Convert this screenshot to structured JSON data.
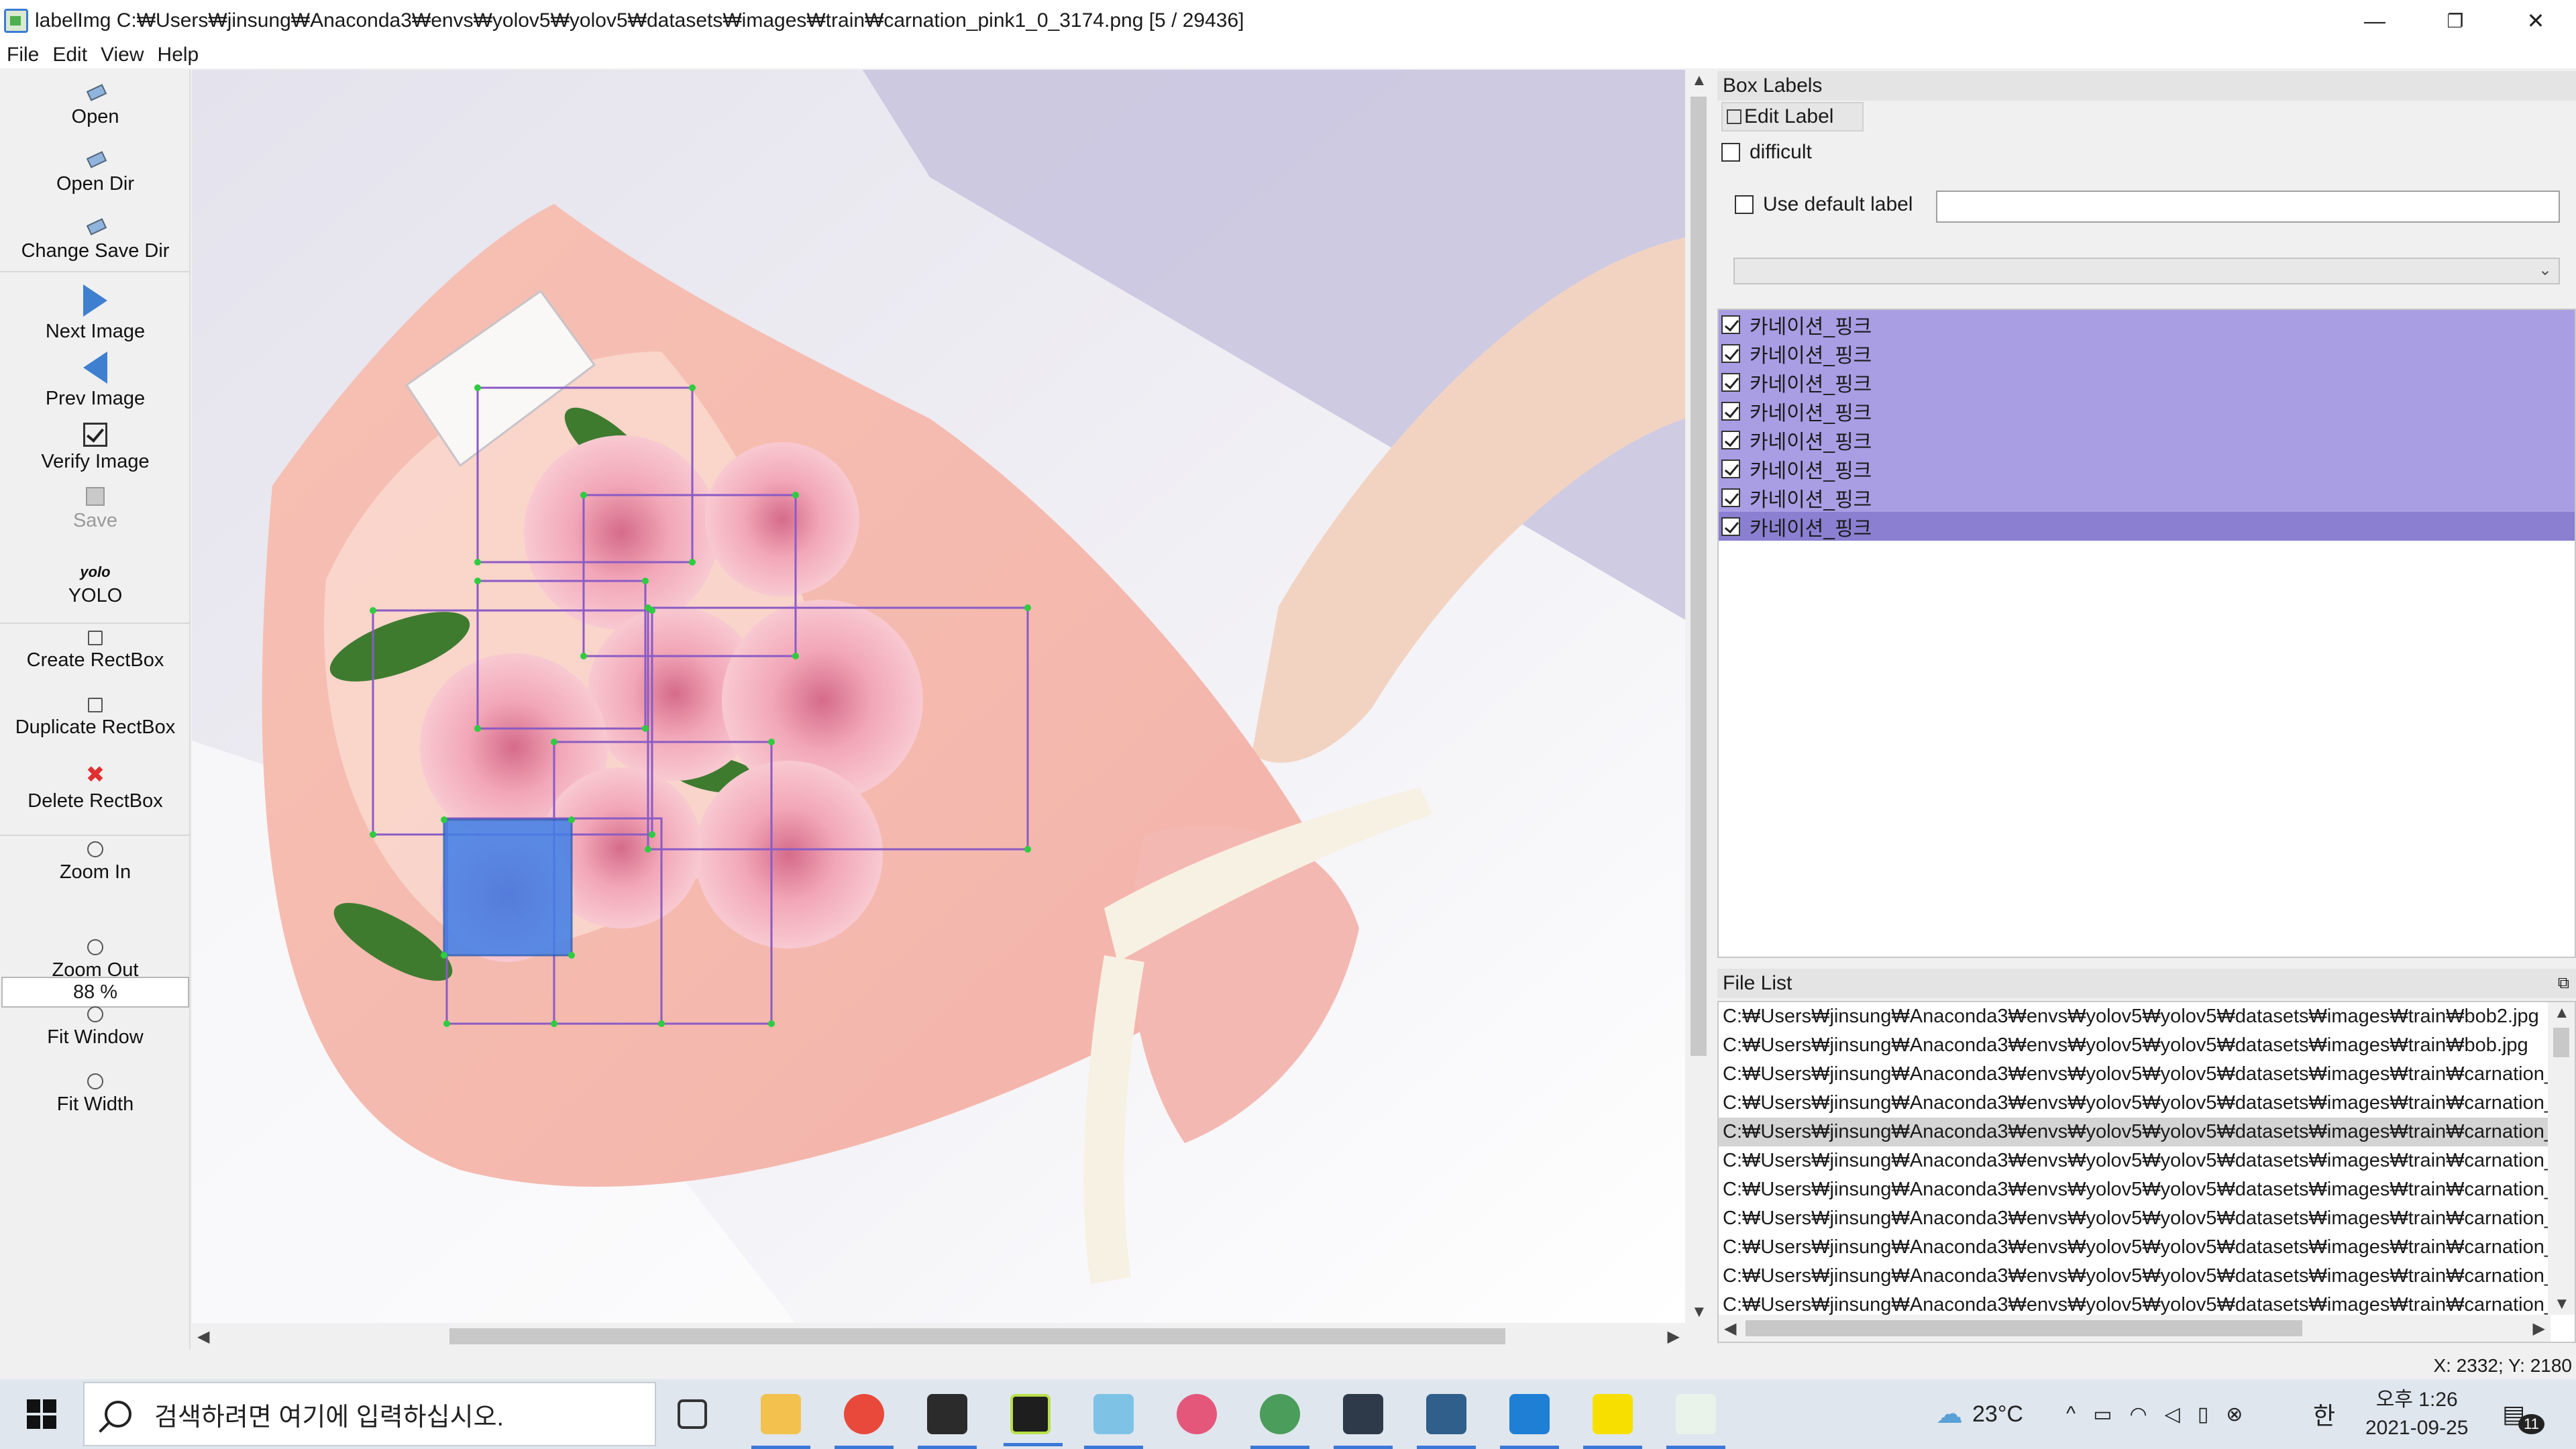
{
  "window": {
    "title": "labelImg C:₩Users₩jinsung₩Anaconda3₩envs₩yolov5₩yolov5₩datasets₩images₩train₩carnation_pink1_0_3174.png [5 / 29436]",
    "minimize": "—",
    "maximize": "❐",
    "close": "✕"
  },
  "menu": [
    "File",
    "Edit",
    "View",
    "Help"
  ],
  "toolbar": {
    "open": "Open",
    "open_dir": "Open Dir",
    "change_save_dir": "Change Save Dir",
    "next_image": "Next Image",
    "prev_image": "Prev Image",
    "verify_image": "Verify Image",
    "save": "Save",
    "yolo_icon": "yolo",
    "yolo": "YOLO",
    "create_rectbox": "Create RectBox",
    "duplicate_rectbox": "Duplicate RectBox",
    "delete_rectbox": "Delete RectBox",
    "zoom_in": "Zoom In",
    "zoom_value": "88 %",
    "zoom_out": "Zoom Out",
    "fit_window": "Fit Window",
    "fit_width": "Fit Width"
  },
  "box_labels": {
    "title": "Box Labels",
    "edit_label": "Edit Label",
    "difficult": "difficult",
    "use_default_label": "Use default label",
    "default_label_value": "",
    "labels": [
      "카네이션_핑크",
      "카네이션_핑크",
      "카네이션_핑크",
      "카네이션_핑크",
      "카네이션_핑크",
      "카네이션_핑크",
      "카네이션_핑크",
      "카네이션_핑크"
    ],
    "selected_index": 7
  },
  "file_list": {
    "title": "File List",
    "files": [
      "C:₩Users₩jinsung₩Anaconda3₩envs₩yolov5₩yolov5₩datasets₩images₩train₩bob2.jpg",
      "C:₩Users₩jinsung₩Anaconda3₩envs₩yolov5₩yolov5₩datasets₩images₩train₩bob.jpg",
      "C:₩Users₩jinsung₩Anaconda3₩envs₩yolov5₩yolov5₩datasets₩images₩train₩carnation_",
      "C:₩Users₩jinsung₩Anaconda3₩envs₩yolov5₩yolov5₩datasets₩images₩train₩carnation_",
      "C:₩Users₩jinsung₩Anaconda3₩envs₩yolov5₩yolov5₩datasets₩images₩train₩carnation_",
      "C:₩Users₩jinsung₩Anaconda3₩envs₩yolov5₩yolov5₩datasets₩images₩train₩carnation_",
      "C:₩Users₩jinsung₩Anaconda3₩envs₩yolov5₩yolov5₩datasets₩images₩train₩carnation_",
      "C:₩Users₩jinsung₩Anaconda3₩envs₩yolov5₩yolov5₩datasets₩images₩train₩carnation_",
      "C:₩Users₩jinsung₩Anaconda3₩envs₩yolov5₩yolov5₩datasets₩images₩train₩carnation_",
      "C:₩Users₩jinsung₩Anaconda3₩envs₩yolov5₩yolov5₩datasets₩images₩train₩carnation_",
      "C:₩Users₩jinsung₩Anaconda3₩envs₩yolov5₩yolov5₩datasets₩images₩train₩carnation_"
    ],
    "selected_index": 4
  },
  "status": {
    "coords": "X: 2332; Y: 2180"
  },
  "taskbar": {
    "search_placeholder": "검색하려면 여기에 입력하십시오.",
    "apps": [
      "task-view",
      "file-explorer",
      "chrome",
      "terminal",
      "pycharm",
      "notepad",
      "paint",
      "chrome-2",
      "mysql",
      "mysql-workbench",
      "vscode",
      "kakaotalk",
      "labelimg"
    ],
    "weather": "23°C",
    "ime": "한",
    "time": "오후 1:26",
    "date": "2021-09-25",
    "notifications": "11"
  },
  "colors": {
    "label_bg": "#a99de4",
    "label_selected": "#8a7fd1",
    "box_stroke": "#8a5bc4",
    "box_fill_selected": "#3f7fe8",
    "vertex": "#2ecc40"
  }
}
